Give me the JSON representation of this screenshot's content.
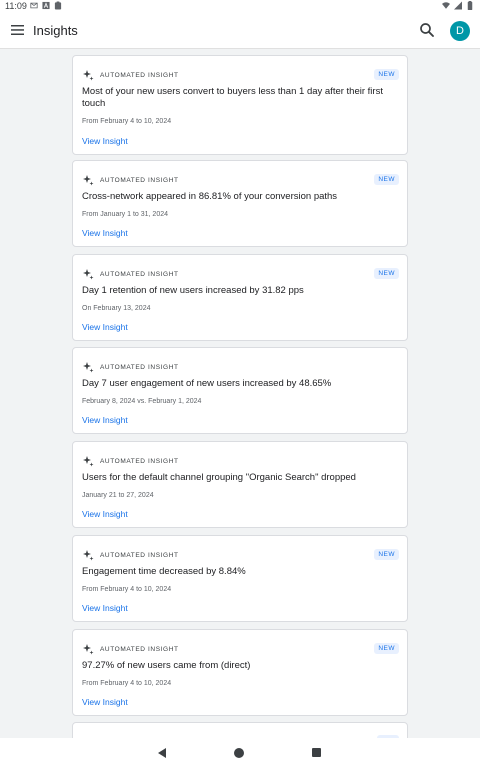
{
  "status_bar": {
    "time": "11:09",
    "left_icons": [
      "gmail-icon",
      "a-icon",
      "clipboard-icon"
    ],
    "right_icons": [
      "wifi-icon",
      "signal-icon",
      "battery-icon"
    ]
  },
  "app_bar": {
    "title": "Insights",
    "avatar_letter": "D",
    "avatar_color": "#0097a7"
  },
  "cards": [
    {
      "label": "AUTOMATED INSIGHT",
      "badge": "NEW",
      "title": "Most of your new users convert to buyers less than 1 day after their first touch",
      "date": "From February 4 to 10, 2024",
      "link": "View Insight"
    },
    {
      "label": "AUTOMATED INSIGHT",
      "badge": "NEW",
      "title": "Cross-network appeared in 86.81% of your conversion paths",
      "date": "From January 1 to 31, 2024",
      "link": "View Insight"
    },
    {
      "label": "AUTOMATED INSIGHT",
      "badge": "NEW",
      "title": "Day 1 retention of new users increased by 31.82 pps",
      "date": "On February 13, 2024",
      "link": "View Insight"
    },
    {
      "label": "AUTOMATED INSIGHT",
      "badge": "",
      "title": "Day 7 user engagement of new users increased by 48.65%",
      "date": "February 8, 2024 vs. February 1, 2024",
      "link": "View Insight"
    },
    {
      "label": "AUTOMATED INSIGHT",
      "badge": "",
      "title": "Users for the default channel grouping \"Organic Search\" dropped",
      "date": "January 21 to 27, 2024",
      "link": "View Insight"
    },
    {
      "label": "AUTOMATED INSIGHT",
      "badge": "NEW",
      "title": "Engagement time decreased by 8.84%",
      "date": "From February 4 to 10, 2024",
      "link": "View Insight"
    },
    {
      "label": "AUTOMATED INSIGHT",
      "badge": "NEW",
      "title": "97.27% of new users came from (direct)",
      "date": "From February 4 to 10, 2024",
      "link": "View Insight"
    }
  ],
  "colors": {
    "accent": "#1a73e8",
    "badge_bg": "#e8f0fe",
    "background": "#f1f3f4"
  }
}
